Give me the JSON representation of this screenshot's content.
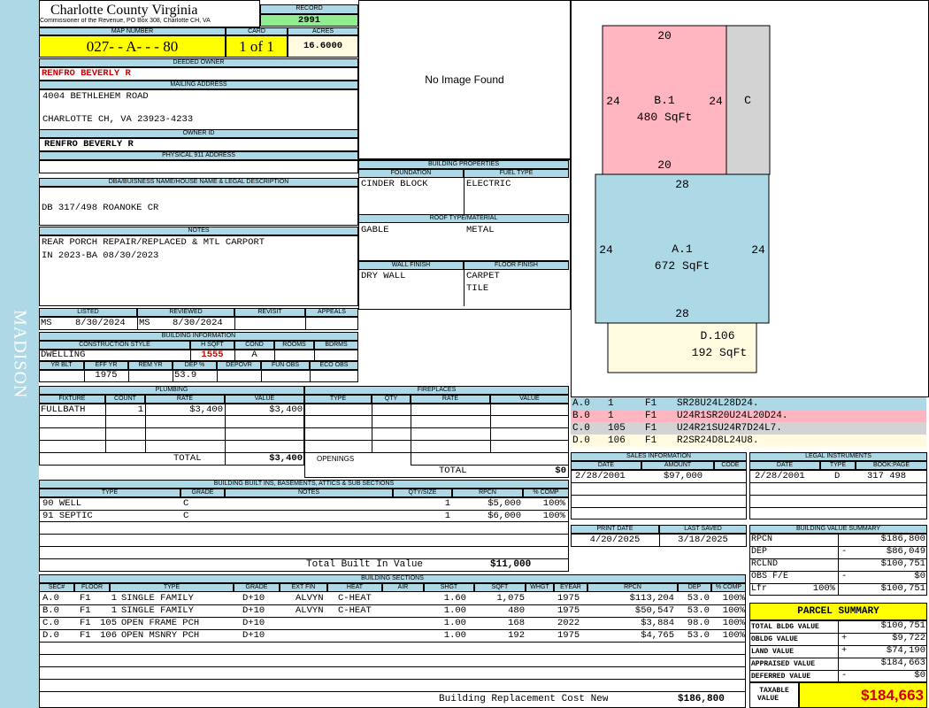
{
  "sidebar": {
    "district": "MADISON"
  },
  "header": {
    "county": "Charlotte County Virginia",
    "address": "Commissioner of the Revenue, PO Box 308, Charlotte CH, VA",
    "record_label": "RECORD",
    "record": "2991"
  },
  "map": {
    "map_label": "MAP NUMBER",
    "map_number": "027- - A- - - 80",
    "card_label": "CARD",
    "card": "1 of 1",
    "acres_label": "ACRES",
    "acres": "16.6000"
  },
  "owner": {
    "deeded_label": "DEEDED OWNER",
    "deeded_owner": "RENFRO BEVERLY R",
    "mailing_label": "MAILING ADDRESS",
    "mail_line1": "4004 BETHLEHEM ROAD",
    "mail_line2": "CHARLOTTE CH, VA 23923-4233",
    "owner_id_label": "OWNER ID",
    "owner_id": "RENFRO BEVERLY R",
    "phys_label": "PHYSICAL 911 ADDRESS",
    "phys": ""
  },
  "legal": {
    "label": "DBA/BUISNESS NAME/HOUSE NAME & LEGAL DESCRIPTION",
    "text": "DB 317/498 ROANOKE CR"
  },
  "notes": {
    "label": "NOTES",
    "line1": "REAR PORCH REPAIR/REPLACED & MTL CARPORT",
    "line2": "IN 2023-BA 08/30/2023"
  },
  "image": {
    "text": "No Image Found"
  },
  "listed": {
    "listed_label": "LISTED",
    "listed_by": "MS",
    "listed_date": "8/30/2024",
    "reviewed_label": "REVIEWED",
    "reviewed_by": "MS",
    "reviewed_date": "8/30/2024",
    "revisit_label": "REVISIT",
    "appeals_label": "APPEALS"
  },
  "building_info": {
    "label": "BUILDING INFORMATION",
    "construction_label": "CONSTRUCTION STYLE",
    "hsqft_label": "H SQFT",
    "cond_label": "COND",
    "rooms_label": "ROOMS",
    "bdrms_label": "BDRMS",
    "construction": "DWELLING",
    "hsqft": "1555",
    "cond": "A",
    "yrblt_label": "YR BLT",
    "effyr_label": "EFF YR",
    "remyr_label": "REM YR",
    "dep_label": "DEP %",
    "depovr_label": "DEPOVR",
    "funobs_label": "FUN OBS",
    "ecoobs_label": "ECO OBS",
    "effyr": "1975",
    "dep": "53.9"
  },
  "props": {
    "label": "BUILDING PROPERTIES",
    "foundation_label": "FOUNDATION",
    "fuel_label": "FUEL TYPE",
    "foundation": "CINDER BLOCK",
    "fuel": "ELECTRIC",
    "roof_label": "ROOF TYPE/MATERIAL",
    "roof_type": "GABLE",
    "roof_material": "METAL",
    "wall_label": "WALL FINISH",
    "floor_label": "FLOOR FINISH",
    "wall": "DRY WALL",
    "floor1": "CARPET",
    "floor2": "TILE"
  },
  "plumbing": {
    "label": "PLUMBING",
    "fixture_label": "FIXTURE",
    "count_label": "COUNT",
    "rate_label": "RATE",
    "value_label": "VALUE",
    "fixture": "FULLBATH",
    "count": "1",
    "rate": "$3,400",
    "value": "$3,400",
    "total_label": "TOTAL",
    "total": "$3,400"
  },
  "fireplaces": {
    "label": "FIREPLACES",
    "type_label": "TYPE",
    "qty_label": "QTY",
    "rate_label": "RATE",
    "value_label": "VALUE",
    "openings_label": "OPENINGS",
    "total_label": "TOTAL",
    "total": "$0"
  },
  "builtins": {
    "label": "BUILDING BUILT INS, BASEMENTS, ATTICS & SUB SECTIONS",
    "type_label": "TYPE",
    "grade_label": "GRADE",
    "notes_label": "NOTES",
    "qty_label": "QTY/SIZE",
    "rpcn_label": "RPCN",
    "comp_label": "% COMP",
    "rows": [
      {
        "type": "90 WELL",
        "grade": "C",
        "qty": "1",
        "rpcn": "$5,000",
        "comp": "100%"
      },
      {
        "type": "91 SEPTIC",
        "grade": "C",
        "qty": "1",
        "rpcn": "$6,000",
        "comp": "100%"
      }
    ],
    "total_label": "Total Built In Value",
    "total": "$11,000"
  },
  "sections": {
    "label": "BUILDING SECTIONS",
    "h_sec": "SEC#",
    "h_floor": "FLOOR",
    "h_type": "TYPE",
    "h_grade": "GRADE",
    "h_ext": "EXT FIN",
    "h_heat": "HEAT",
    "h_air": "AIR",
    "h_shgt": "SHGT",
    "h_sqft": "SQFT",
    "h_whgt": "WHGT",
    "h_eyear": "EYEAR",
    "h_rpcn": "RPCN",
    "h_dep": "DEP",
    "h_comp": "% COMP",
    "rows": [
      {
        "sec": "A.0",
        "floor": "F1",
        "code": "1",
        "type": "SINGLE FAMILY",
        "grade": "D+10",
        "ext": "ALVYN",
        "heat": "C-HEAT",
        "shgt": "1.60",
        "sqft": "1,075",
        "eyear": "1975",
        "rpcn": "$113,204",
        "dep": "53.0",
        "comp": "100%"
      },
      {
        "sec": "B.0",
        "floor": "F1",
        "code": "1",
        "type": "SINGLE FAMILY",
        "grade": "D+10",
        "ext": "ALVYN",
        "heat": "C-HEAT",
        "shgt": "1.00",
        "sqft": "480",
        "eyear": "1975",
        "rpcn": "$50,547",
        "dep": "53.0",
        "comp": "100%"
      },
      {
        "sec": "C.0",
        "floor": "F1",
        "code": "105",
        "type": "OPEN FRAME PCH",
        "grade": "D+10",
        "ext": "",
        "heat": "",
        "shgt": "1.00",
        "sqft": "168",
        "eyear": "2022",
        "rpcn": "$3,884",
        "dep": "98.0",
        "comp": "100%"
      },
      {
        "sec": "D.0",
        "floor": "F1",
        "code": "106",
        "type": "OPEN MSNRY PCH",
        "grade": "D+10",
        "ext": "",
        "heat": "",
        "shgt": "1.00",
        "sqft": "192",
        "eyear": "1975",
        "rpcn": "$4,765",
        "dep": "53.0",
        "comp": "100%"
      }
    ],
    "brcn_label": "Building Replacement Cost New",
    "brcn": "$186,800"
  },
  "sketch": {
    "b_top": "20",
    "b_left": "24",
    "b_right": "24",
    "b_label": "B.1",
    "b_area": "480 SqFt",
    "b_bottom": "20",
    "c_label": "C",
    "a_top": "28",
    "a_left": "24",
    "a_right": "24",
    "a_label": "A.1",
    "a_area": "672 SqFt",
    "a_bottom": "28",
    "d_label": "D.106",
    "d_area": "192 SqFt",
    "colors": {
      "A": "#add8e6",
      "B": "#ffb6c1",
      "C": "#d3d3d3",
      "D": "#fffae0"
    }
  },
  "legend": [
    {
      "sec": "A.0",
      "code": "1",
      "floor": "F1",
      "path": "SR28U24L28D24.",
      "color": "#add8e6"
    },
    {
      "sec": "B.0",
      "code": "1",
      "floor": "F1",
      "path": "U24R1SR20U24L20D24.",
      "color": "#ffb6c1"
    },
    {
      "sec": "C.0",
      "code": "105",
      "floor": "F1",
      "path": "U24R21SU24R7D24L7.",
      "color": "#d3d3d3"
    },
    {
      "sec": "D.0",
      "code": "106",
      "floor": "F1",
      "path": "R2SR24D8L24U8.",
      "color": "#fffae0"
    }
  ],
  "sales": {
    "label": "SALES INFORMATION",
    "date_label": "DATE",
    "amount_label": "AMOUNT",
    "code_label": "CODE",
    "date": "2/28/2001",
    "amount": "$97,000"
  },
  "legal_inst": {
    "label": "LEGAL INSTRUMENTS",
    "date_label": "DATE",
    "type_label": "TYPE",
    "book_label": "BOOK:PAGE",
    "date": "2/28/2001",
    "type": "D",
    "book": "317 498"
  },
  "print": {
    "print_label": "PRINT DATE",
    "saved_label": "LAST SAVED",
    "print_date": "4/20/2025",
    "saved_date": "3/18/2025"
  },
  "bvs": {
    "label": "BUILDING VALUE SUMMARY",
    "rpcn_label": "RPCN",
    "rpcn": "$186,800",
    "dep_label": "DEP",
    "dep_sign": "-",
    "dep": "$86,049",
    "rclnd_label": "RCLND",
    "rclnd": "$100,751",
    "obs_label": "OBS F/E",
    "obs_sign": "-",
    "obs": "$0",
    "lfr_label": "Lfr",
    "lfr_pct": "100%",
    "lfr": "$100,751"
  },
  "parcel": {
    "label": "PARCEL SUMMARY",
    "tbv_label": "TOTAL BLDG VALUE",
    "tbv": "$100,751",
    "obldg_label": "OBLDG VALUE",
    "obldg_sign": "+",
    "obldg": "$9,722",
    "land_label": "LAND VALUE",
    "land_sign": "+",
    "land": "$74,190",
    "appr_label": "APPRAISED VALUE",
    "appr": "$184,663",
    "def_label": "DEFERRED VALUE",
    "def_sign": "-",
    "def": "$0",
    "taxable_label1": "TAXABLE",
    "taxable_label2": "VALUE",
    "taxable": "$184,663"
  }
}
